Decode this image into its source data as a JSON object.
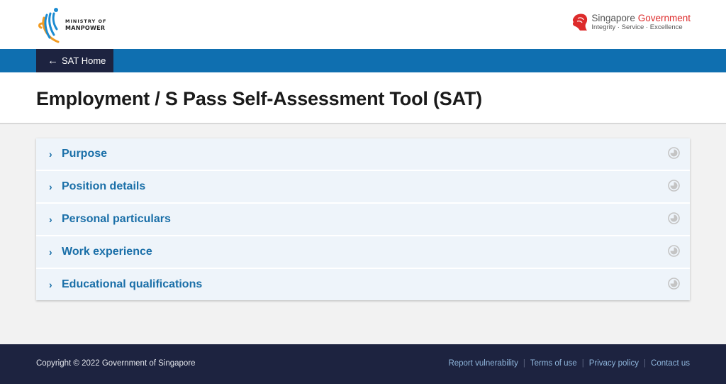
{
  "header": {
    "ministry_logo": {
      "line1": "MINISTRY OF",
      "line2": "MANPOWER"
    },
    "gov_logo": {
      "name_part1": "Singapore",
      "name_part2": "Government",
      "tagline": "Integrity · Service · Excellence"
    }
  },
  "nav": {
    "home_button": {
      "icon": "arrow-left-icon",
      "label": "SAT Home"
    }
  },
  "page": {
    "title": "Employment / S Pass Self-Assessment Tool (SAT)"
  },
  "accordion": {
    "items": [
      {
        "label": "Purpose",
        "status_icon": "incomplete-status-icon"
      },
      {
        "label": "Position details",
        "status_icon": "incomplete-status-icon"
      },
      {
        "label": "Personal particulars",
        "status_icon": "incomplete-status-icon"
      },
      {
        "label": "Work experience",
        "status_icon": "incomplete-status-icon"
      },
      {
        "label": "Educational qualifications",
        "status_icon": "incomplete-status-icon"
      }
    ]
  },
  "footer": {
    "copyright": "Copyright © 2022 Government of Singapore",
    "links": [
      {
        "label": "Report vulnerability"
      },
      {
        "label": "Terms of use"
      },
      {
        "label": "Privacy policy"
      },
      {
        "label": "Contact us"
      }
    ],
    "separator": "|"
  },
  "colors": {
    "nav_band": "#0f6fb0",
    "dark_navy": "#1d2340",
    "accent_blue": "#1a6fa8",
    "accordion_bg": "#eef4fa",
    "gov_red": "#dd2b2b"
  }
}
